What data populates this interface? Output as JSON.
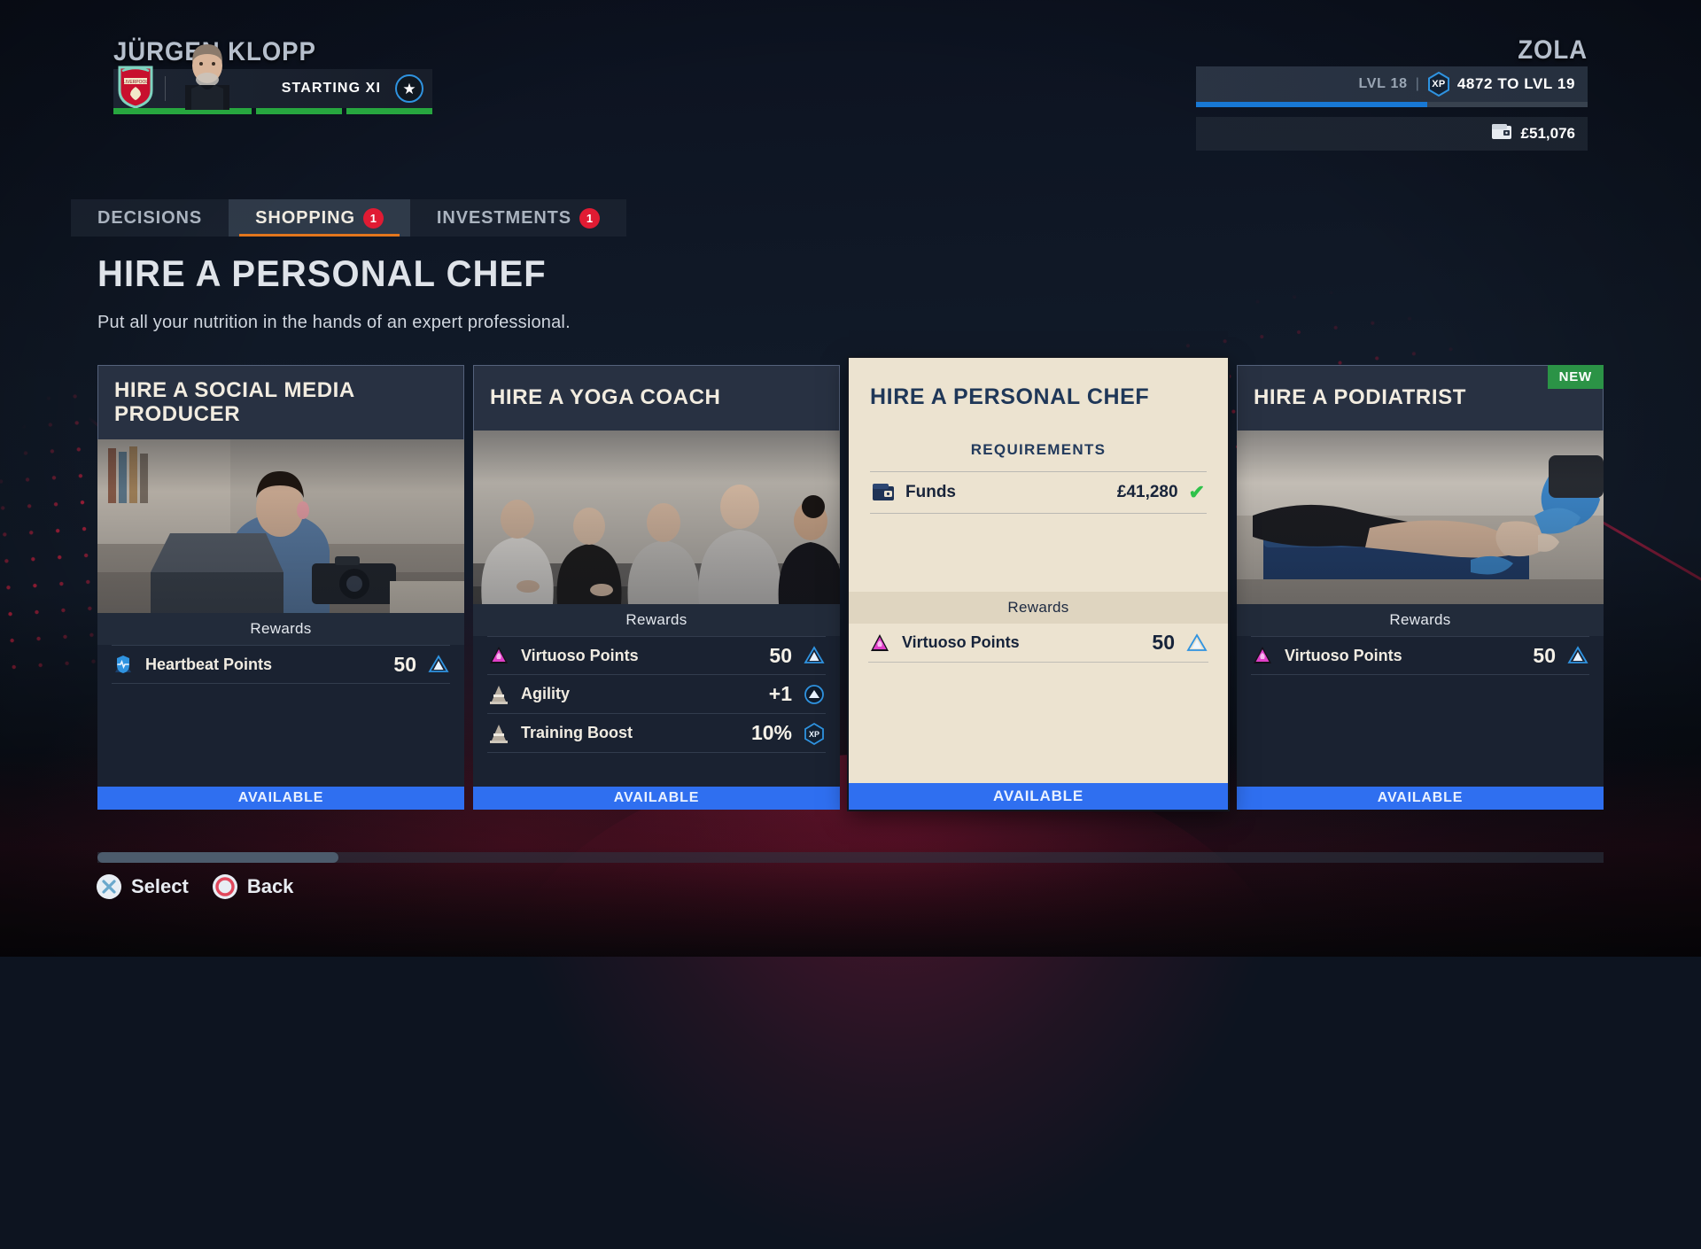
{
  "header": {
    "manager": {
      "name": "JÜRGEN KLOPP",
      "squad_label": "STARTING XI",
      "club_icon": "liverpool-crest-icon",
      "star_icon": "star-icon"
    },
    "player": {
      "name": "ZOLA",
      "level_label": "LVL 18",
      "separator": "|",
      "xp_icon_label": "XP",
      "xp_text": "4872 TO LVL  19",
      "xp_progress_percent": 59,
      "funds_icon": "wallet-icon",
      "funds": "£51,076"
    }
  },
  "tabs": [
    {
      "label": "DECISIONS",
      "badge": "",
      "active": false
    },
    {
      "label": "SHOPPING",
      "badge": "1",
      "active": true
    },
    {
      "label": "INVESTMENTS",
      "badge": "1",
      "active": false
    }
  ],
  "page": {
    "title": "HIRE A PERSONAL CHEF",
    "subtitle": "Put all your nutrition in the hands of an expert professional."
  },
  "rewards_heading": "Rewards",
  "requirements_heading": "REQUIREMENTS",
  "cards": [
    {
      "title": "HIRE A SOCIAL MEDIA PRODUCER",
      "photo": "person-with-laptop-and-camera-photo",
      "badge": "",
      "selected": false,
      "status": "AVAILABLE",
      "rewards": [
        {
          "icon": "heartbeat-shield-icon",
          "name": "Heartbeat Points",
          "value": "50",
          "tag": "blue-triangle-icon"
        }
      ]
    },
    {
      "title": "HIRE A YOGA COACH",
      "photo": "yoga-class-meditation-photo",
      "badge": "",
      "selected": false,
      "status": "AVAILABLE",
      "rewards": [
        {
          "icon": "virtuoso-triangle-icon",
          "name": "Virtuoso Points",
          "value": "50",
          "tag": "blue-triangle-icon"
        },
        {
          "icon": "training-cone-icon",
          "name": "Agility",
          "value": "+1",
          "tag": "blue-up-arrow-icon"
        },
        {
          "icon": "training-cone-icon",
          "name": "Training Boost",
          "value": "10%",
          "tag": "xp-hex-icon"
        }
      ]
    },
    {
      "title": "HIRE A PERSONAL CHEF",
      "photo": "",
      "badge": "",
      "selected": true,
      "status": "AVAILABLE",
      "requirements": [
        {
          "icon": "wallet-icon",
          "label": "Funds",
          "value": "£41,280",
          "met": true,
          "check": "✔"
        }
      ],
      "rewards": [
        {
          "icon": "virtuoso-triangle-icon",
          "name": "Virtuoso Points",
          "value": "50",
          "tag": "blue-triangle-icon"
        }
      ]
    },
    {
      "title": "HIRE A PODIATRIST",
      "photo": "podiatrist-treating-foot-photo",
      "badge": "NEW",
      "selected": false,
      "status": "AVAILABLE",
      "rewards": [
        {
          "icon": "virtuoso-triangle-icon",
          "name": "Virtuoso Points",
          "value": "50",
          "tag": "blue-triangle-icon"
        }
      ]
    }
  ],
  "footer_hints": [
    {
      "button": "cross-button-icon",
      "label": "Select"
    },
    {
      "button": "circle-button-icon",
      "label": "Back"
    }
  ],
  "colors": {
    "accent_orange": "#e2761d",
    "badge_red": "#e01b33",
    "status_blue": "#2f6ff0",
    "new_green": "#2b9346",
    "xp_blue": "#1878d4",
    "selected_cream": "#ece3d0",
    "check_green": "#2fc24a"
  }
}
